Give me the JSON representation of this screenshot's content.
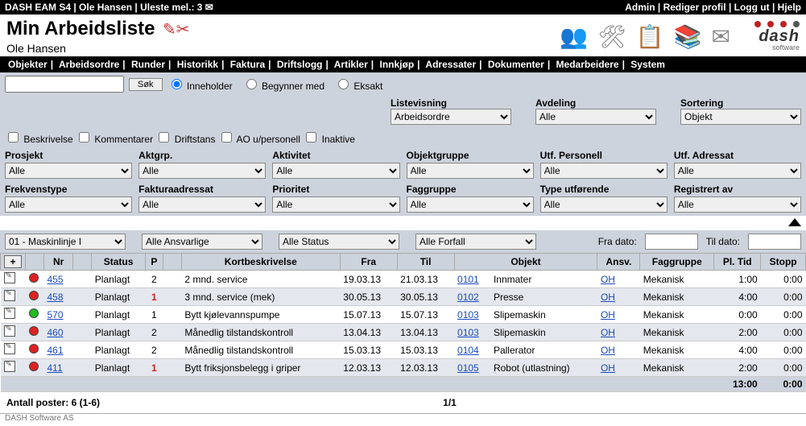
{
  "topbar": {
    "left": "DASH EAM S4 | Ole Hansen | Uleste mel.: 3 ✉",
    "admin": "Admin",
    "edit_profile": "Rediger profil",
    "logout": "Logg ut",
    "help": "Hjelp"
  },
  "header": {
    "title": "Min Arbeidsliste",
    "subtitle": "Ole Hansen",
    "logo_text": "dash",
    "logo_sub": "software"
  },
  "menu": {
    "items": [
      "Objekter",
      "Arbeidsordre",
      "Runder",
      "Historikk",
      "Faktura",
      "Driftslogg",
      "Artikler",
      "Innkjøp",
      "Adressater",
      "Dokumenter",
      "Medarbeidere",
      "System"
    ]
  },
  "search": {
    "button": "Søk",
    "mode_contains": "Inneholder",
    "mode_begins": "Begynner med",
    "mode_exact": "Eksakt",
    "chk_desc": "Beskrivelse",
    "chk_comments": "Kommentarer",
    "chk_downtime": "Driftstans",
    "chk_ao": "AO u/personell",
    "chk_inactive": "Inaktive"
  },
  "listview": {
    "label": "Listevisning",
    "value": "Arbeidsordre",
    "dept_label": "Avdeling",
    "dept_value": "Alle",
    "sort_label": "Sortering",
    "sort_value": "Objekt"
  },
  "filters": {
    "row1": [
      {
        "label": "Prosjekt",
        "value": "Alle"
      },
      {
        "label": "Aktgrp.",
        "value": "Alle"
      },
      {
        "label": "Aktivitet",
        "value": "Alle"
      },
      {
        "label": "Objektgruppe",
        "value": "Alle"
      },
      {
        "label": "Utf. Personell",
        "value": "Alle"
      },
      {
        "label": "Utf. Adressat",
        "value": "Alle"
      }
    ],
    "row2": [
      {
        "label": "Frekvenstype",
        "value": "Alle"
      },
      {
        "label": "Fakturaadressat",
        "value": "Alle"
      },
      {
        "label": "Prioritet",
        "value": "Alle"
      },
      {
        "label": "Faggruppe",
        "value": "Alle"
      },
      {
        "label": "Type utførende",
        "value": "Alle"
      },
      {
        "label": "Registrert av",
        "value": "Alle"
      }
    ]
  },
  "quick": {
    "line": "01 - Maskinlinje I",
    "responsible": "Alle Ansvarlige",
    "status": "Alle Status",
    "due": "Alle Forfall",
    "from_label": "Fra dato:",
    "to_label": "Til dato:"
  },
  "table": {
    "headers": {
      "add": "+",
      "nr": "Nr",
      "status": "Status",
      "p": "P",
      "short": "Kortbeskrivelse",
      "from": "Fra",
      "to": "Til",
      "object": "Objekt",
      "resp": "Ansv.",
      "group": "Faggruppe",
      "plan": "Pl. Tid",
      "stop": "Stopp"
    },
    "rows": [
      {
        "dot": "red",
        "nr": "455",
        "status": "Planlagt",
        "p": "2",
        "pred": false,
        "short": "2 mnd. service",
        "from": "19.03.13",
        "to": "21.03.13",
        "objnr": "0101",
        "obj": "Innmater",
        "resp": "OH",
        "group": "Mekanisk",
        "plan": "1:00",
        "stop": "0:00"
      },
      {
        "dot": "red",
        "nr": "458",
        "status": "Planlagt",
        "p": "1",
        "pred": true,
        "short": "3 mnd. service (mek)",
        "from": "30.05.13",
        "to": "30.05.13",
        "objnr": "0102",
        "obj": "Presse",
        "resp": "OH",
        "group": "Mekanisk",
        "plan": "4:00",
        "stop": "0:00"
      },
      {
        "dot": "green",
        "nr": "570",
        "status": "Planlagt",
        "p": "1",
        "pred": false,
        "short": "Bytt kjølevannspumpe",
        "from": "15.07.13",
        "to": "15.07.13",
        "objnr": "0103",
        "obj": "Slipemaskin",
        "resp": "OH",
        "group": "Mekanisk",
        "plan": "0:00",
        "stop": "0:00"
      },
      {
        "dot": "red",
        "nr": "460",
        "status": "Planlagt",
        "p": "2",
        "pred": false,
        "short": "Månedlig tilstandskontroll",
        "from": "13.04.13",
        "to": "13.04.13",
        "objnr": "0103",
        "obj": "Slipemaskin",
        "resp": "OH",
        "group": "Mekanisk",
        "plan": "2:00",
        "stop": "0:00"
      },
      {
        "dot": "red",
        "nr": "461",
        "status": "Planlagt",
        "p": "2",
        "pred": false,
        "short": "Månedlig tilstandskontroll",
        "from": "15.03.13",
        "to": "15.03.13",
        "objnr": "0104",
        "obj": "Pallerator",
        "resp": "OH",
        "group": "Mekanisk",
        "plan": "4:00",
        "stop": "0:00"
      },
      {
        "dot": "red",
        "nr": "411",
        "status": "Planlagt",
        "p": "1",
        "pred": true,
        "short": "Bytt friksjonsbelegg i griper",
        "from": "12.03.13",
        "to": "12.03.13",
        "objnr": "0105",
        "obj": "Robot (utlastning)",
        "resp": "OH",
        "group": "Mekanisk",
        "plan": "2:00",
        "stop": "0:00"
      }
    ],
    "sum": {
      "plan": "13:00",
      "stop": "0:00"
    }
  },
  "footer": {
    "count": "Antall poster: 6 (1-6)",
    "page": "1/1",
    "copyright": "DASH Software AS"
  }
}
